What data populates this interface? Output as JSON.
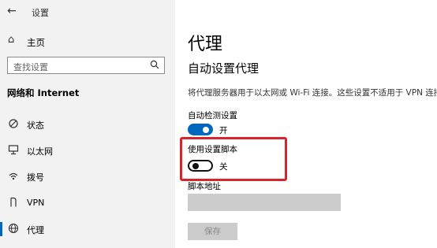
{
  "sidebar": {
    "app_title": "设置",
    "home_label": "主页",
    "search_placeholder": "查找设置",
    "section_title": "网络和 Internet",
    "items": [
      {
        "label": "状态",
        "icon": "status-icon"
      },
      {
        "label": "以太网",
        "icon": "ethernet-icon"
      },
      {
        "label": "拨号",
        "icon": "dialup-icon"
      },
      {
        "label": "VPN",
        "icon": "vpn-icon"
      },
      {
        "label": "代理",
        "icon": "globe-icon"
      }
    ]
  },
  "main": {
    "title": "代理",
    "subtitle": "自动设置代理",
    "description": "将代理服务器用于以太网或 Wi-Fi 连接。这些设置不适用于 VPN 连接。",
    "auto_detect": {
      "label": "自动检测设置",
      "state": "开"
    },
    "use_script": {
      "label": "使用设置脚本",
      "state": "关"
    },
    "script_address_label": "脚本地址",
    "save_label": "保存"
  },
  "colors": {
    "accent": "#0067c0",
    "highlight": "#d9232d",
    "sidebar_bg": "#f2f2f2",
    "disabled": "#cccccc"
  }
}
